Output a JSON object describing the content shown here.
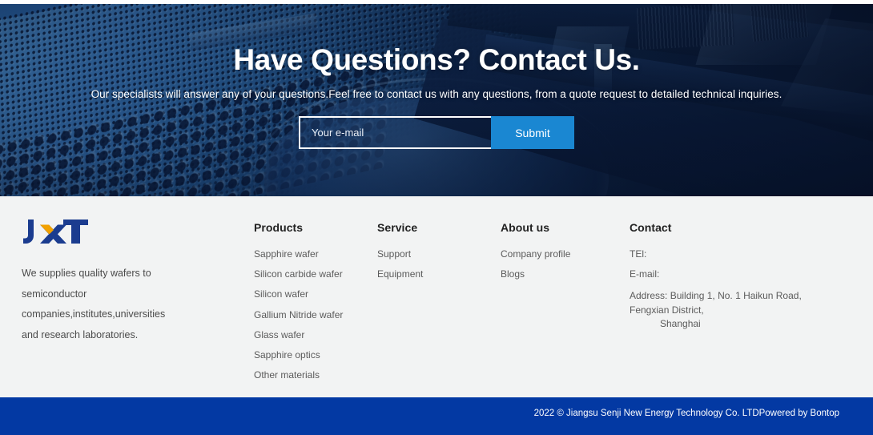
{
  "hero": {
    "title": "Have Questions? Contact Us.",
    "subtitle": "Our specialists will answer any of your questions.Feel free to contact us with any questions, from a quote request to detailed technical inquiries.",
    "email_placeholder": "Your e-mail",
    "email_value": "",
    "submit_label": "Submit"
  },
  "footer": {
    "brand": {
      "logo_text": "JXT",
      "description": "We supplies quality wafers to semiconductor companies,institutes,universities and research laboratories."
    },
    "columns": [
      {
        "title": "Products",
        "items": [
          "Sapphire wafer",
          "Silicon carbide wafer",
          "Silicon wafer",
          "Gallium Nitride wafer",
          "Glass wafer",
          "Sapphire optics",
          "Other materials"
        ]
      },
      {
        "title": "Service",
        "items": [
          "Support",
          "Equipment"
        ]
      },
      {
        "title": "About us",
        "items": [
          "Company profile",
          "Blogs"
        ]
      }
    ],
    "contact": {
      "title": "Contact",
      "tel_label": "TEl:",
      "email_label": "E-mail:",
      "address_line1": "Address: Building 1, No. 1 Haikun Road, Fengxian District,",
      "address_line2": "Shanghai"
    }
  },
  "copyright": {
    "text": "2022 © Jiangsu Senji New Energy Technology Co. LTDPowered by Bontop"
  },
  "colors": {
    "brand_blue": "#0339a3",
    "logo_blue": "#1b3c8f",
    "logo_orange": "#f2a100",
    "submit_blue": "#1a87d2",
    "footer_bg": "#f2f3f3",
    "hero_dark": "#0d2350"
  }
}
